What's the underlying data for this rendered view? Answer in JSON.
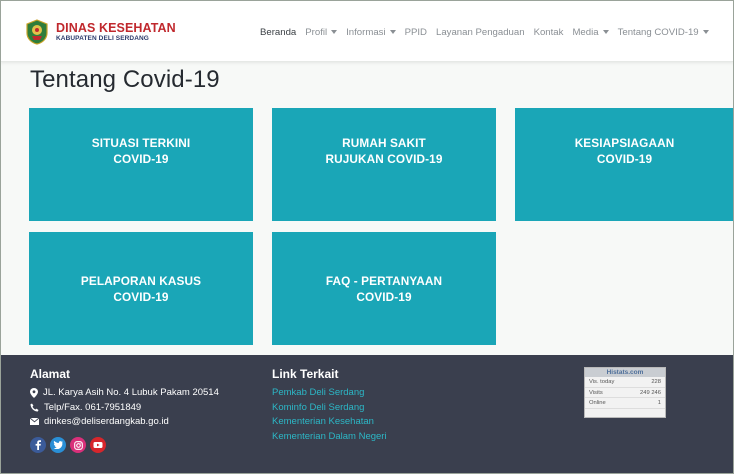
{
  "brand": {
    "title": "DINAS KESEHATAN",
    "subtitle": "KABUPATEN DELI SERDANG"
  },
  "nav": {
    "items": [
      {
        "label": "Beranda",
        "dropdown": false,
        "active": true
      },
      {
        "label": "Profil",
        "dropdown": true
      },
      {
        "label": "Informasi",
        "dropdown": true
      },
      {
        "label": "PPID",
        "dropdown": false
      },
      {
        "label": "Layanan Pengaduan",
        "dropdown": false
      },
      {
        "label": "Kontak",
        "dropdown": false
      },
      {
        "label": "Media",
        "dropdown": true
      },
      {
        "label": "Tentang COVID-19",
        "dropdown": true
      }
    ]
  },
  "page": {
    "title": "Tentang Covid-19"
  },
  "tiles": [
    {
      "label": "SITUASI TERKINI\nCOVID-19"
    },
    {
      "label": "RUMAH SAKIT\nRUJUKAN COVID-19"
    },
    {
      "label": "KESIAPSIAGAAN\nCOVID-19"
    },
    {
      "label": "PELAPORAN KASUS\nCOVID-19"
    },
    {
      "label": "FAQ - PERTANYAAN\nCOVID-19"
    }
  ],
  "footer": {
    "address": {
      "heading": "Alamat",
      "street": "JL. Karya Asih No. 4 Lubuk Pakam 20514",
      "phone": "Telp/Fax. 061-7951849",
      "email": "dinkes@deliserdangkab.go.id"
    },
    "links": {
      "heading": "Link Terkait",
      "items": [
        "Pemkab Deli Serdang",
        "Kominfo Deli Serdang",
        "Kementerian Kesehatan",
        "Kementerian Dalam Negeri"
      ]
    },
    "social": [
      "facebook-icon",
      "twitter-icon",
      "instagram-icon",
      "youtube-icon"
    ],
    "histats": {
      "title": "Histats.com",
      "rows": [
        {
          "label": "Vis. today",
          "value": "228"
        },
        {
          "label": "Visits",
          "value": "249 246"
        },
        {
          "label": "Online",
          "value": "1"
        }
      ]
    }
  },
  "colors": {
    "tile": "#1aa6b7",
    "footer": "#3a3f4e",
    "brand_red": "#c0282d",
    "link": "#2cb7c6"
  }
}
